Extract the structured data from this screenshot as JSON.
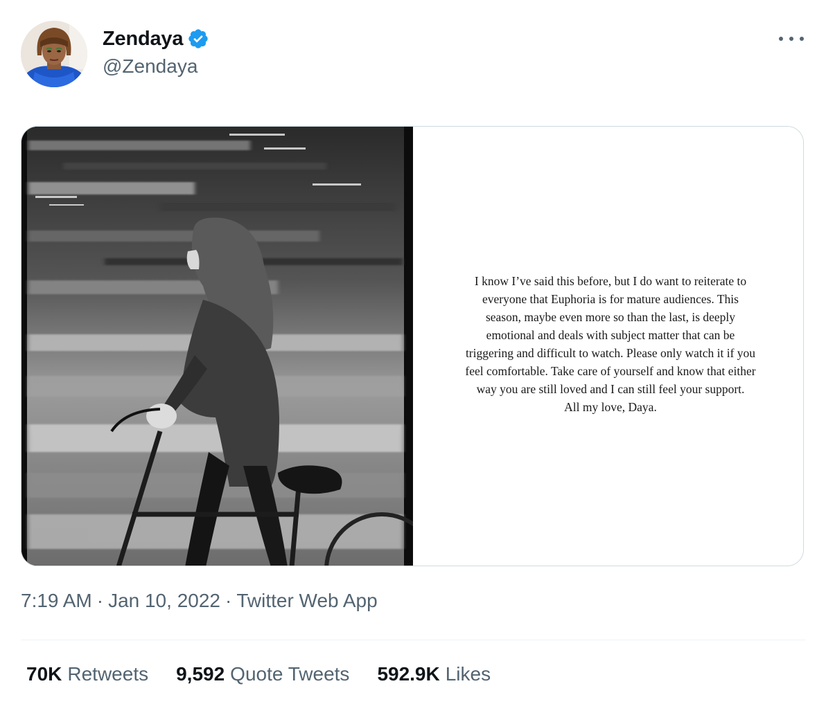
{
  "author": {
    "display_name": "Zendaya",
    "handle": "@Zendaya",
    "verified": true,
    "verified_color": "#1d9bf0",
    "avatar_icon": "profile-photo"
  },
  "more_menu_icon": "more-horizontal-icon",
  "media": {
    "photo_icon": "photo-image",
    "note_text": "I know I’ve said this before, but I do want to reiterate to\neveryone that Euphoria is for mature audiences. This\nseason, maybe even more so than the last, is deeply\nemotional and deals with subject matter that can be\ntriggering and difficult to watch. Please only watch it if you\nfeel comfortable. Take care of yourself and know that either\nway you are still loved and I can still feel your support.\nAll my love, Daya."
  },
  "meta": {
    "time": "7:19 AM",
    "separator": "·",
    "date": "Jan 10, 2022",
    "source": "Twitter Web App"
  },
  "stats": [
    {
      "count": "70K",
      "label": "Retweets"
    },
    {
      "count": "9,592",
      "label": "Quote Tweets"
    },
    {
      "count": "592.9K",
      "label": "Likes"
    }
  ]
}
